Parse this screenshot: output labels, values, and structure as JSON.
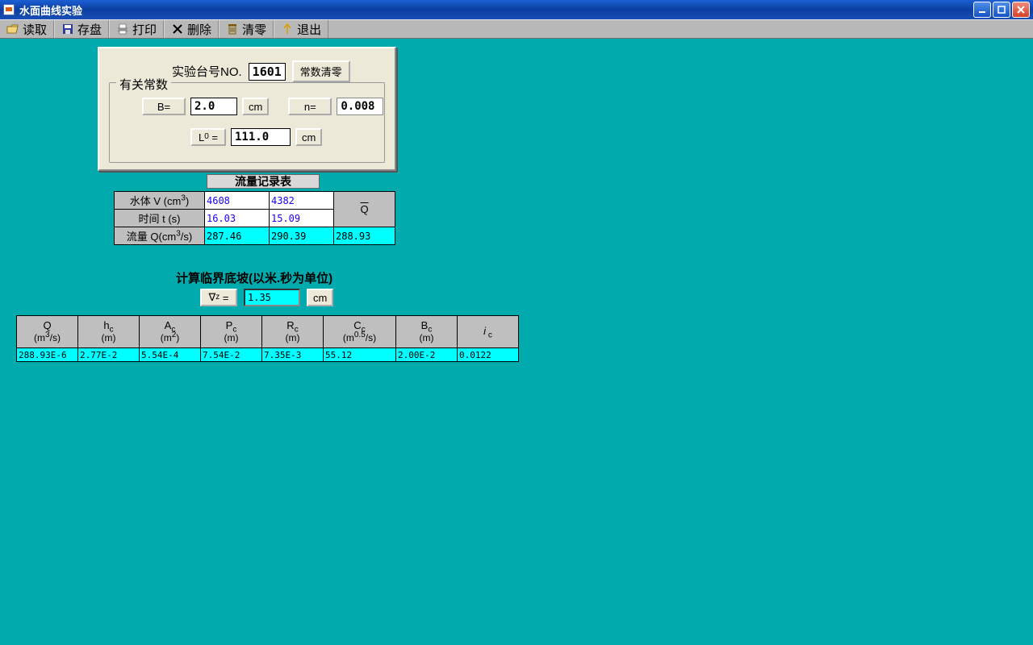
{
  "window": {
    "title": "水面曲线实验"
  },
  "toolbar": {
    "read": "读取",
    "save": "存盘",
    "print": "打印",
    "delete": "删除",
    "clear": "清零",
    "exit": "退出"
  },
  "panel1": {
    "station_label": "实验台号NO.",
    "station_value": "1601",
    "clear_btn": "常数清零",
    "fieldset_legend": "有关常数",
    "B_label": "B=",
    "B_value": "2.0",
    "B_unit": "cm",
    "n_label": "n=",
    "n_value": "0.008",
    "L0_label": "L₀ =",
    "L0_value": "111.0",
    "L0_unit": "cm"
  },
  "sect2": {
    "title": "流量记录表",
    "row_v_label": "水体 V (cm³)",
    "row_t_label": "时间 t (s)",
    "row_q_label": "流量 Q(cm³/s)",
    "v1": "4608",
    "v2": "4382",
    "t1": "16.03",
    "t2": "15.09",
    "q1": "287.46",
    "q2": "290.39",
    "qbar_label": "Q̄",
    "qbar_value": "288.93"
  },
  "sect3": {
    "title": "计算临界底坡(以米.秒为单位)",
    "vz_label": "∇z =",
    "vz_value": "1.35",
    "vz_unit": "cm"
  },
  "tbl3": {
    "headers": {
      "Q": {
        "top": "Q",
        "sub": "(m³/s)"
      },
      "hc": {
        "top": "hc",
        "sub": "(m)"
      },
      "Ac": {
        "top": "Ac",
        "sub": "(m²)"
      },
      "Pc": {
        "top": "Pc",
        "sub": "(m)"
      },
      "Rc": {
        "top": "Rc",
        "sub": "(m)"
      },
      "Cc": {
        "top": "Cc",
        "sub": "(m⁰·⁵/s)"
      },
      "Bc": {
        "top": "Bc",
        "sub": "(m)"
      },
      "ic": {
        "top": "i c",
        "sub": ""
      }
    },
    "row": {
      "Q": "288.93E-6",
      "hc": "2.77E-2",
      "Ac": "5.54E-4",
      "Pc": "7.54E-2",
      "Rc": "7.35E-3",
      "Cc": "55.12",
      "Bc": "2.00E-2",
      "ic": "0.0122"
    }
  }
}
